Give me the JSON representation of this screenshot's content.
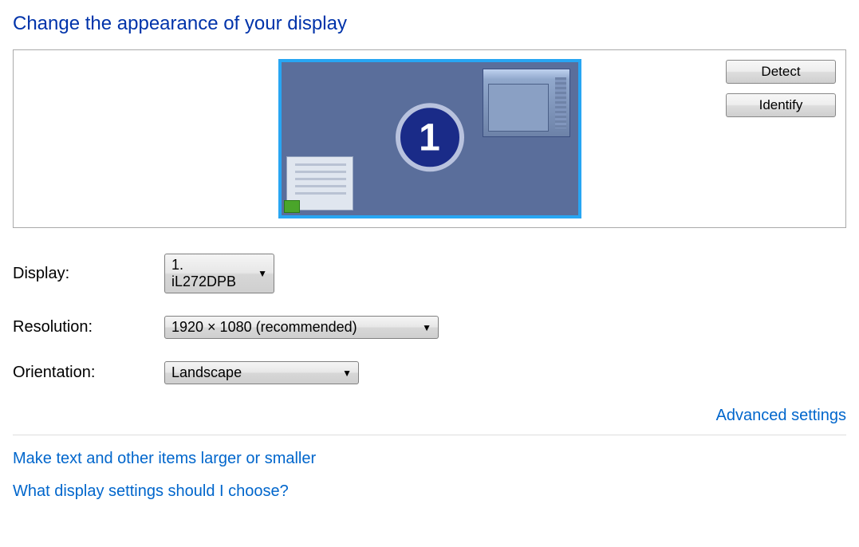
{
  "title": "Change the appearance of your display",
  "preview": {
    "detect_label": "Detect",
    "identify_label": "Identify",
    "monitor_number": "1"
  },
  "fields": {
    "display": {
      "label": "Display:",
      "value": "1. iL272DPB"
    },
    "resolution": {
      "label": "Resolution:",
      "value": "1920 × 1080 (recommended)"
    },
    "orientation": {
      "label": "Orientation:",
      "value": "Landscape"
    }
  },
  "links": {
    "advanced": "Advanced settings",
    "text_size": "Make text and other items larger or smaller",
    "help": "What display settings should I choose?"
  }
}
